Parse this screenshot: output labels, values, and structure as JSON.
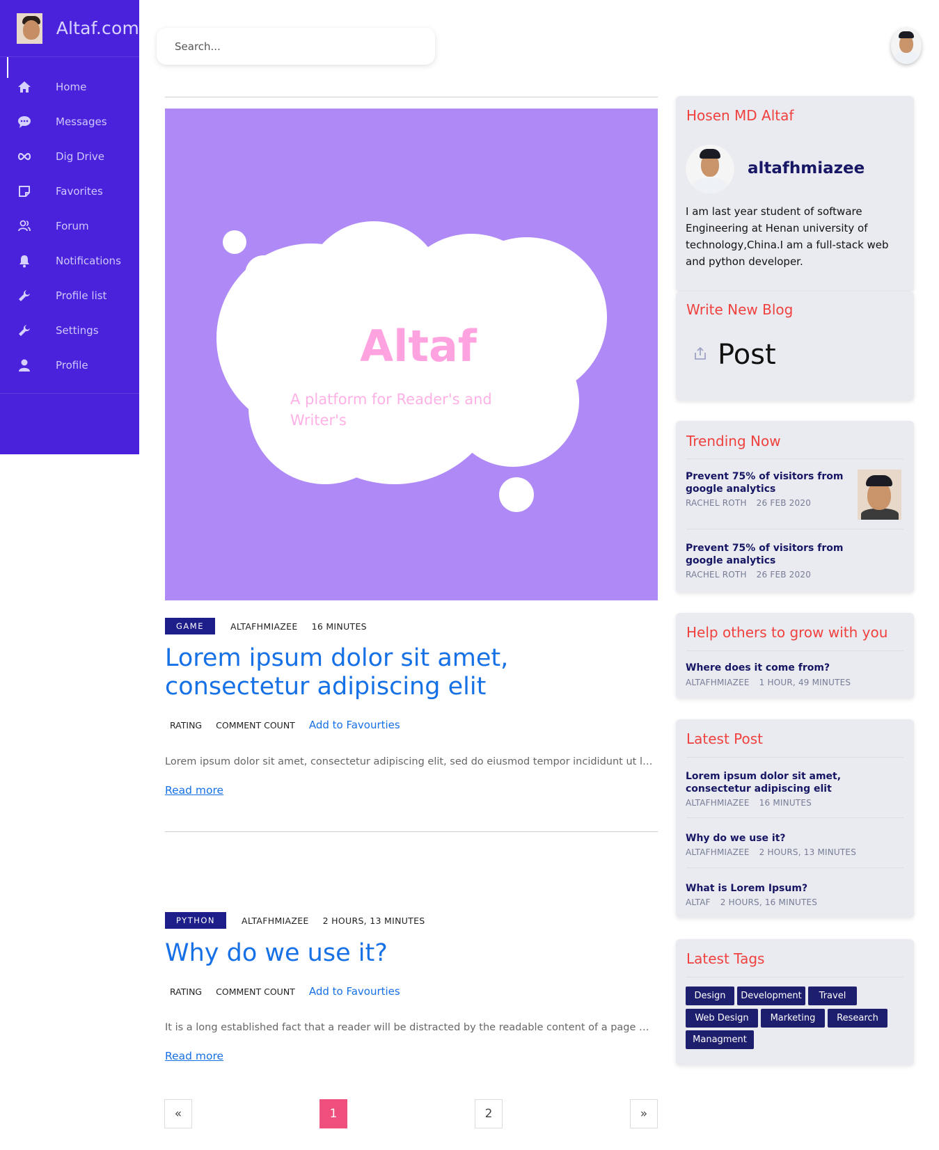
{
  "brand": {
    "title": "Altaf.com"
  },
  "sidebar": {
    "items": [
      {
        "label": "Home",
        "icon": "home-icon"
      },
      {
        "label": "Messages",
        "icon": "chat-bubble-icon"
      },
      {
        "label": "Dig Drive",
        "icon": "infinity-icon"
      },
      {
        "label": "Favorites",
        "icon": "sticky-note-icon"
      },
      {
        "label": "Forum",
        "icon": "users-icon"
      },
      {
        "label": "Notifications",
        "icon": "bell-icon"
      },
      {
        "label": "Profile list",
        "icon": "wrench-icon"
      },
      {
        "label": "Settings",
        "icon": "wrench-icon"
      },
      {
        "label": "Profile",
        "icon": "user-icon"
      }
    ]
  },
  "search": {
    "placeholder": "Search..."
  },
  "hero": {
    "title": "Altaf",
    "subtitle": "A platform for Reader's  and Writer's"
  },
  "posts": [
    {
      "tag": "GAME",
      "author": "ALTAFHMIAZEE",
      "time": "16 MINUTES",
      "title": "Lorem ipsum dolor sit amet, consectetur adipiscing elit",
      "rating": "RATING",
      "comments": "COMMENT COUNT",
      "favourite": "Add to Favourties",
      "excerpt": "Lorem ipsum dolor sit amet, consectetur adipiscing elit, sed do eiusmod tempor incididunt ut labore et dolore magna aliqua.",
      "read_more": "Read more"
    },
    {
      "tag": "PYTHON",
      "author": "ALTAFHMIAZEE",
      "time": "2 HOURS, 13 MINUTES",
      "title": "Why do we use it?",
      "rating": "RATING",
      "comments": "COMMENT COUNT",
      "favourite": "Add to Favourties",
      "excerpt": "It is a long established fact that a reader will be distracted by the readable content of a page when looking at its layout.",
      "read_more": "Read more"
    }
  ],
  "pagination": {
    "prev": "«",
    "pages": [
      "1",
      "2"
    ],
    "current": "1",
    "next": "»"
  },
  "profile_card": {
    "title": "Hosen MD Altaf",
    "username": "altafhmiazee",
    "bio": "I am last year student of software Engineering at Henan university of technology,China.I am a full-stack web and python developer."
  },
  "write_card": {
    "title": "Write New Blog",
    "button": "Post",
    "icon": "share-icon"
  },
  "trending": {
    "title": "Trending Now",
    "items": [
      {
        "title": "Prevent 75% of visitors from google analytics",
        "author": "RACHEL ROTH",
        "date": "26 FEB 2020"
      },
      {
        "title": "Prevent 75% of visitors from google analytics",
        "author": "RACHEL ROTH",
        "date": "26 FEB 2020"
      }
    ]
  },
  "help": {
    "title": "Help others to grow with you",
    "items": [
      {
        "title": "Where does it come from?",
        "author": "ALTAFHMIAZEE",
        "time": "1 HOUR, 49 MINUTES"
      }
    ]
  },
  "latest": {
    "title": "Latest Post",
    "items": [
      {
        "title": "Lorem ipsum dolor sit amet, consectetur adipiscing elit",
        "author": "ALTAFHMIAZEE",
        "time": "16 MINUTES"
      },
      {
        "title": "Why do we use it?",
        "author": "ALTAFHMIAZEE",
        "time": "2 HOURS, 13 MINUTES"
      },
      {
        "title": "What is Lorem Ipsum?",
        "author": "ALTAF",
        "time": "2 HOURS, 16 MINUTES"
      }
    ]
  },
  "tags_card": {
    "title": "Latest Tags",
    "tags": [
      "Design",
      "Development",
      "Travel",
      "Web Design",
      "Marketing",
      "Research",
      "Managment"
    ]
  },
  "colors": {
    "sidebar": "#4a22dc",
    "accent_red": "#f0413f",
    "link_blue": "#1670e6",
    "navy": "#1e1e6e",
    "hero_bg": "#af8af7",
    "page_active": "#ef4f7d"
  }
}
